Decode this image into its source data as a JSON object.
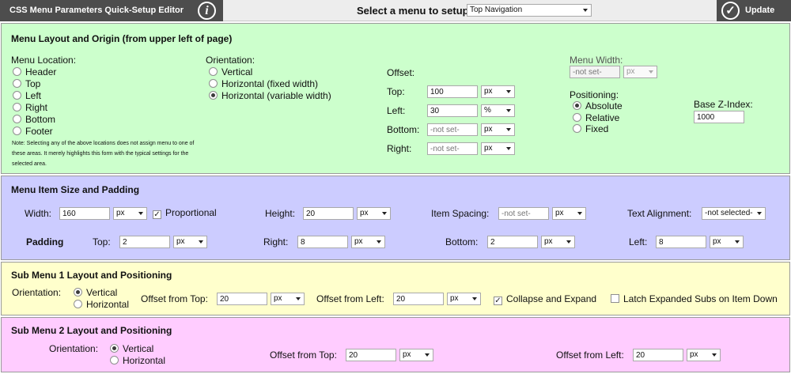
{
  "header": {
    "title": "CSS Menu Parameters Quick-Setup Editor",
    "select_label": "Select a menu to setup:",
    "selected_menu": "Top Navigation",
    "update_label": "Update"
  },
  "layout": {
    "title": "Menu Layout and Origin (from upper left of page)",
    "location_label": "Menu Location:",
    "locations": [
      "Header",
      "Top",
      "Left",
      "Right",
      "Bottom",
      "Footer"
    ],
    "note": "Note: Selecting any of the above locations does not assign menu to one of these areas. It merely highlights this form with the typical settings for the selected area.",
    "orientation_label": "Orientation:",
    "orientations": [
      "Vertical",
      "Horizontal (fixed width)",
      "Horizontal (variable width)"
    ],
    "selected_orientation": "Horizontal (variable width)",
    "offset_label": "Offset:",
    "top_label": "Top:",
    "top_value": "100",
    "top_unit": "px",
    "left_label": "Left:",
    "left_value": "30",
    "left_unit": "%",
    "bottom_label": "Bottom:",
    "bottom_placeholder": "-not set-",
    "bottom_unit": "px",
    "right_label": "Right:",
    "right_placeholder": "-not set-",
    "right_unit": "px",
    "width_label": "Menu Width:",
    "width_placeholder": "-not set-",
    "width_unit": "px",
    "positioning_label": "Positioning:",
    "positionings": [
      "Absolute",
      "Relative",
      "Fixed"
    ],
    "selected_positioning": "Absolute",
    "zindex_label": "Base Z-Index:",
    "zindex_value": "1000"
  },
  "item": {
    "title": "Menu Item Size and Padding",
    "width_label": "Width:",
    "width_value": "160",
    "width_unit": "px",
    "proportional_label": "Proportional",
    "height_label": "Height:",
    "height_value": "20",
    "height_unit": "px",
    "spacing_label": "Item Spacing:",
    "spacing_placeholder": "-not set-",
    "spacing_unit": "px",
    "align_label": "Text Alignment:",
    "align_value": "-not selected-",
    "padding_label": "Padding",
    "pad_top_label": "Top:",
    "pad_top_value": "2",
    "pad_top_unit": "px",
    "pad_right_label": "Right:",
    "pad_right_value": "8",
    "pad_right_unit": "px",
    "pad_bottom_label": "Bottom:",
    "pad_bottom_value": "2",
    "pad_bottom_unit": "px",
    "pad_left_label": "Left:",
    "pad_left_value": "8",
    "pad_left_unit": "px"
  },
  "sub1": {
    "title": "Sub Menu 1 Layout and Positioning",
    "orientation_label": "Orientation:",
    "vertical_label": "Vertical",
    "horizontal_label": "Horizontal",
    "selected_orientation": "Vertical",
    "top_label": "Offset from Top:",
    "top_value": "20",
    "top_unit": "px",
    "left_label": "Offset from Left:",
    "left_value": "20",
    "left_unit": "px",
    "collapse_label": "Collapse and Expand",
    "collapse_checked": true,
    "latch_label": "Latch Expanded Subs on Item Down",
    "latch_checked": false
  },
  "sub2": {
    "title": "Sub Menu 2 Layout and Positioning",
    "orientation_label": "Orientation:",
    "vertical_label": "Vertical",
    "horizontal_label": "Horizontal",
    "selected_orientation": "Vertical",
    "top_label": "Offset from Top:",
    "top_value": "20",
    "top_unit": "px",
    "left_label": "Offset from Left:",
    "left_value": "20",
    "left_unit": "px"
  },
  "colors": {
    "header_dark": "#4d4d4d",
    "layout_panel": "#ccffcc",
    "item_panel": "#ccccff",
    "sub1_panel": "#ffffcc",
    "sub2_panel": "#ffccff"
  }
}
